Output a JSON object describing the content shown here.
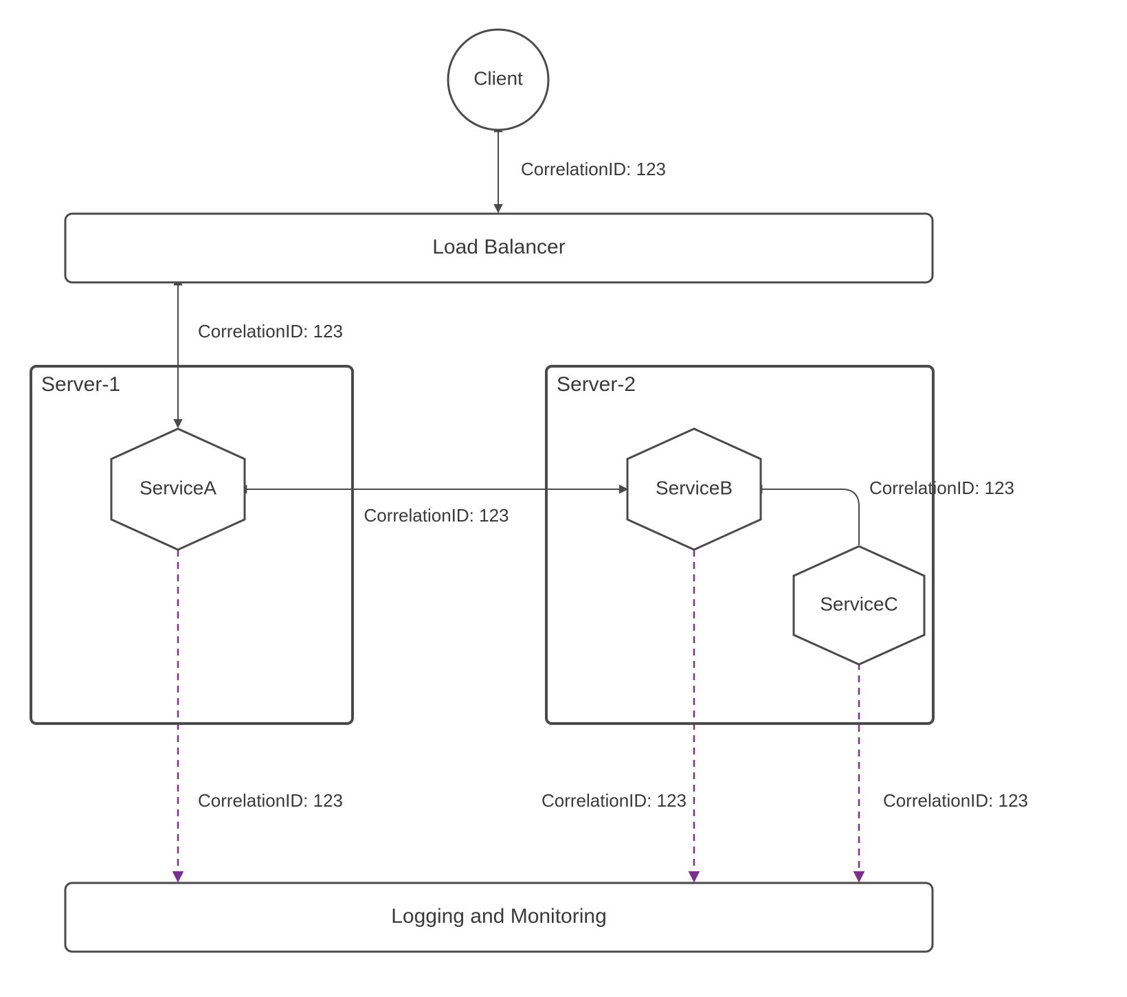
{
  "nodes": {
    "client": {
      "label": "Client"
    },
    "loadBalancer": {
      "label": "Load Balancer"
    },
    "serviceA": {
      "label": "ServiceA"
    },
    "serviceB": {
      "label": "ServiceB"
    },
    "serviceC": {
      "label": "ServiceC"
    },
    "logging": {
      "label": "Logging and Monitoring"
    }
  },
  "groups": {
    "server1": {
      "label": "Server-1"
    },
    "server2": {
      "label": "Server-2"
    }
  },
  "edges": {
    "clientToLB": {
      "label": "CorrelationID: 123"
    },
    "lbToServiceA": {
      "label": "CorrelationID: 123"
    },
    "serviceAserviceB": {
      "label": "CorrelationID: 123"
    },
    "serviceBserviceC": {
      "label": "CorrelationID: 123"
    },
    "serviceAtoLog": {
      "label": "CorrelationID: 123"
    },
    "serviceBtoLog": {
      "label": "CorrelationID: 123"
    },
    "serviceCtoLog": {
      "label": "CorrelationID: 123"
    }
  },
  "colors": {
    "stroke": "#4a4a4a",
    "dashed": "#7b2f8f",
    "text": "#3a3a3a"
  }
}
